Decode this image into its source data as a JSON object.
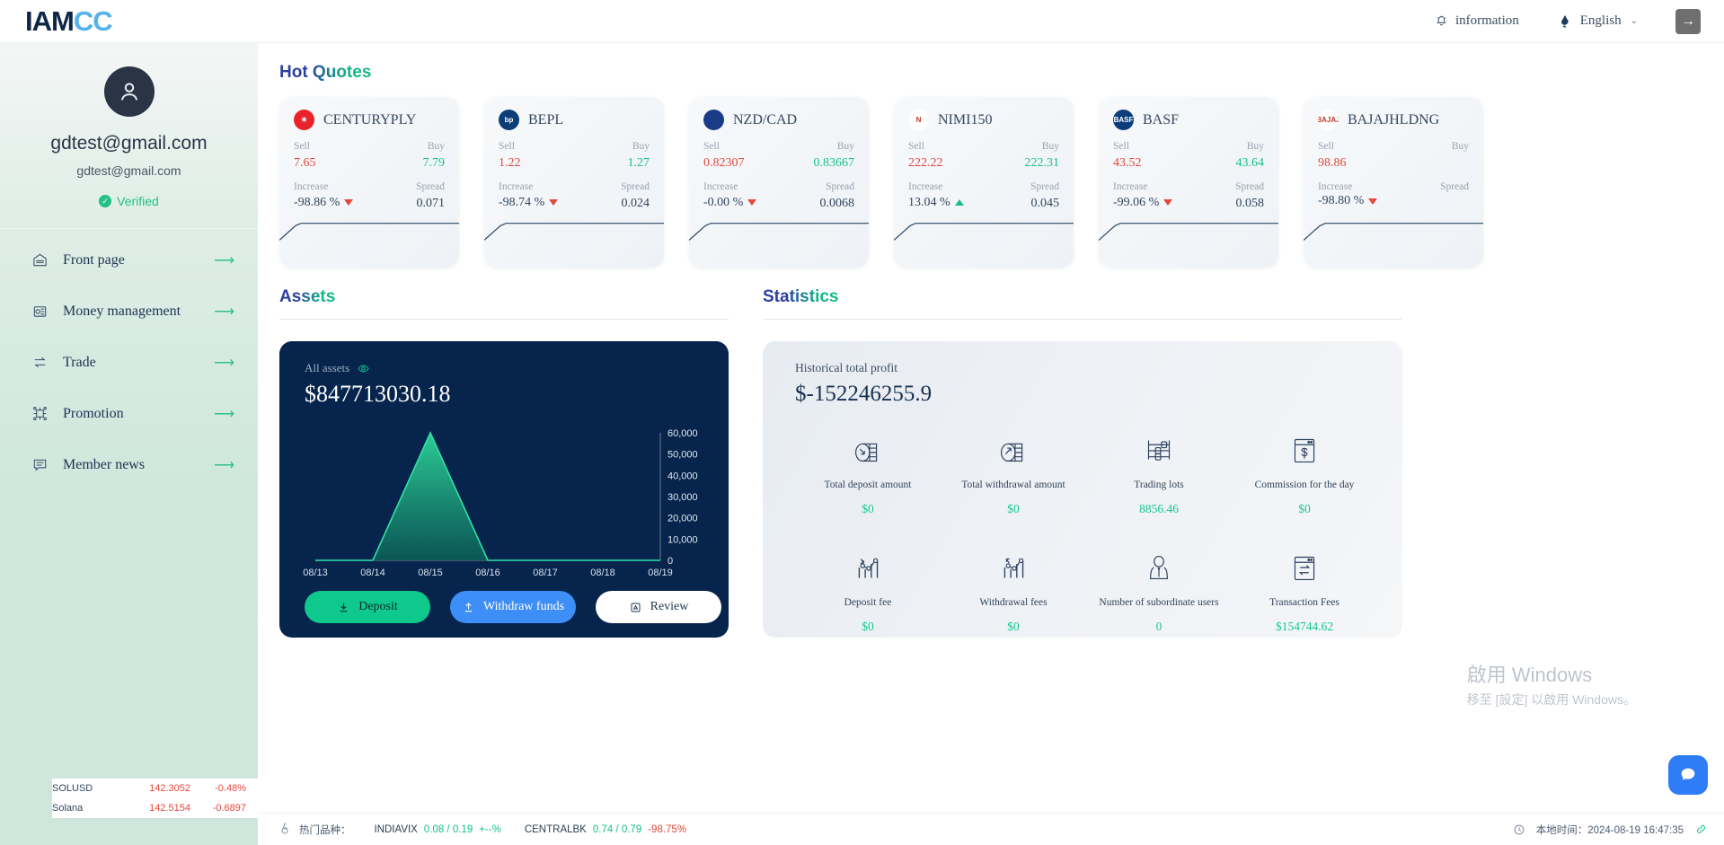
{
  "header": {
    "logo_dark_1": "IAM",
    "logo_blue": "CC",
    "information_label": "information",
    "language_label": "English",
    "chevron": "⌄",
    "logout_glyph": "→"
  },
  "sidebar": {
    "email_primary": "gdtest@gmail.com",
    "email_secondary": "gdtest@gmail.com",
    "verified_label": "Verified",
    "verified_check": "✓",
    "arrow": "⟶",
    "items": [
      {
        "label": "Front page",
        "icon": "home-icon"
      },
      {
        "label": "Money management",
        "icon": "money-icon"
      },
      {
        "label": "Trade",
        "icon": "exchange-icon"
      },
      {
        "label": "Promotion",
        "icon": "network-icon"
      },
      {
        "label": "Member news",
        "icon": "news-icon"
      }
    ]
  },
  "hot_quotes": {
    "title": "Hot Quotes",
    "labels": {
      "sell": "Sell",
      "buy": "Buy",
      "increase": "Increase",
      "spread": "Spread"
    },
    "cards": [
      {
        "symbol": "CENTURYPLY",
        "logo_text": "✳",
        "logo_bg": "#e8242a",
        "sell": "7.65",
        "buy": "7.79",
        "increase": "-98.86 %",
        "direction": "down",
        "spread": "0.071"
      },
      {
        "symbol": "BEPL",
        "logo_text": "bp",
        "logo_bg": "#0b3d77",
        "sell": "1.22",
        "buy": "1.27",
        "increase": "-98.74 %",
        "direction": "down",
        "spread": "0.024"
      },
      {
        "symbol": "NZD/CAD",
        "logo_text": "",
        "logo_bg": "#1b3a87",
        "sell": "0.82307",
        "buy": "0.83667",
        "increase": "-0.00 %",
        "direction": "down",
        "spread": "0.0068"
      },
      {
        "symbol": "NIMI150",
        "logo_text": "N",
        "logo_bg": "#ffffff",
        "sell": "222.22",
        "buy": "222.31",
        "increase": "13.04 %",
        "direction": "up",
        "spread": "0.045"
      },
      {
        "symbol": "BASF",
        "logo_text": "BASF",
        "logo_bg": "#0a3d7c",
        "sell": "43.52",
        "buy": "43.64",
        "increase": "-99.06 %",
        "direction": "down",
        "spread": "0.058"
      },
      {
        "symbol": "BAJAJHLDNG",
        "logo_text": "BAJAJ",
        "logo_bg": "#ffffff",
        "sell": "98.86",
        "buy": "",
        "increase": "-98.80 %",
        "direction": "down",
        "spread": ""
      }
    ]
  },
  "assets": {
    "title": "Assets",
    "all_assets_label": "All assets",
    "amount": "$847713030.18",
    "buttons": [
      {
        "label": "Deposit",
        "icon": "download-icon"
      },
      {
        "label": "Withdraw funds",
        "icon": "upload-icon"
      },
      {
        "label": "Review",
        "icon": "document-icon"
      }
    ]
  },
  "chart_data": {
    "type": "area",
    "title": "",
    "categories": [
      "08/13",
      "08/14",
      "08/15",
      "08/16",
      "08/17",
      "08/18",
      "08/19"
    ],
    "values": [
      0,
      0,
      60000,
      0,
      0,
      0,
      0
    ],
    "xlabel": "",
    "ylabel": "",
    "ylim": [
      0,
      60000
    ],
    "yticks": [
      "60,000",
      "50,000",
      "40,000",
      "30,000",
      "20,000",
      "10,000",
      "0"
    ],
    "grid": false,
    "legend": "none",
    "axis_position": "right"
  },
  "statistics": {
    "title": "Statistics",
    "historical_label": "Historical total profit",
    "historical_value": "$-152246255.9",
    "cells": [
      {
        "name": "Total deposit amount",
        "value": "$0",
        "icon": "coins-down-icon"
      },
      {
        "name": "Total withdrawal amount",
        "value": "$0",
        "icon": "coins-up-icon"
      },
      {
        "name": "Trading lots",
        "value": "8856.46",
        "icon": "abacus-icon"
      },
      {
        "name": "Commission for the day",
        "value": "$0",
        "icon": "dollar-window-icon"
      },
      {
        "name": "Deposit fee",
        "value": "$0",
        "icon": "chart-down-icon"
      },
      {
        "name": "Withdrawal fees",
        "value": "$0",
        "icon": "chart-up-icon"
      },
      {
        "name": "Number of subordinate users",
        "value": "0",
        "icon": "person-icon"
      },
      {
        "name": "Transaction Fees",
        "value": "$154744.62",
        "icon": "transfer-window-icon"
      }
    ]
  },
  "watermark": {
    "line1": "啟用 Windows",
    "line2": "移至 [設定] 以啟用 Windows。"
  },
  "mini_list": [
    {
      "symbol": "SOLUSD",
      "price": "142.3052",
      "change": "-0.48%"
    },
    {
      "symbol": "Solana",
      "price": "142.5154",
      "change": "-0.6897"
    }
  ],
  "ticker": {
    "hot_label": "热门品种：",
    "items": [
      {
        "symbol": "INDIAVIX",
        "pair": "0.08 / 0.19",
        "change": "+--%",
        "change_kind": "neutral"
      },
      {
        "symbol": "CENTRALBK",
        "pair": "0.74 / 0.79",
        "change": "-98.75%",
        "change_kind": "down"
      }
    ],
    "local_time_label": "本地时间：2024-08-19 16:47:35"
  }
}
